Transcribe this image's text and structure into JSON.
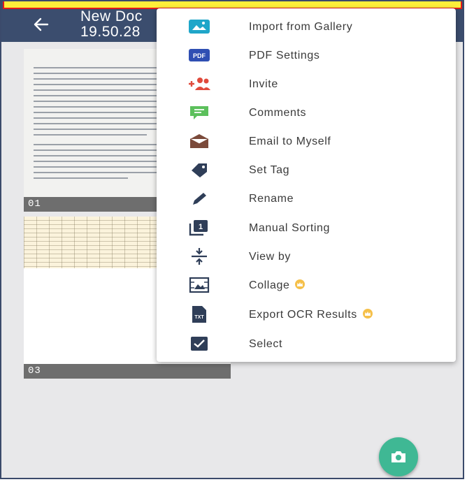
{
  "header": {
    "title_line1": "New Doc",
    "title_line2": "19.50.28",
    "back_icon": "arrow-left-icon"
  },
  "pages": [
    {
      "label": "01"
    },
    {
      "label": "03"
    }
  ],
  "menu": {
    "items": [
      {
        "label": "Import from Gallery",
        "icon": "image-icon",
        "color": "#1fa6c9"
      },
      {
        "label": "PDF Settings",
        "icon": "pdf-icon",
        "color": "#2f4fb3",
        "icon_text": "PDF"
      },
      {
        "label": "Invite",
        "icon": "add-people-icon",
        "color": "#e04a3c"
      },
      {
        "label": "Comments",
        "icon": "comment-icon",
        "color": "#5cc05c"
      },
      {
        "label": "Email to Myself",
        "icon": "envelope-icon",
        "color": "#7b4a3a"
      },
      {
        "label": "Set Tag",
        "icon": "tag-icon",
        "color": "#2f3e58"
      },
      {
        "label": "Rename",
        "icon": "pencil-icon",
        "color": "#2f3e58"
      },
      {
        "label": "Manual Sorting",
        "icon": "sort-icon",
        "color": "#2f3e58",
        "icon_text": "1"
      },
      {
        "label": "View by",
        "icon": "view-by-icon",
        "color": "#2f3e58"
      },
      {
        "label": "Collage",
        "icon": "collage-icon",
        "color": "#2f3e58",
        "premium": true
      },
      {
        "label": "Export OCR Results",
        "icon": "txt-file-icon",
        "color": "#2f3e58",
        "icon_text": "TXT",
        "premium": true
      },
      {
        "label": "Select",
        "icon": "checkbox-icon",
        "color": "#2f3e58"
      }
    ]
  },
  "fab": {
    "icon": "camera-icon",
    "color": "#3fb894"
  },
  "annotation_colors": {
    "fill": "#ffef3a",
    "border": "#e21b1b"
  }
}
